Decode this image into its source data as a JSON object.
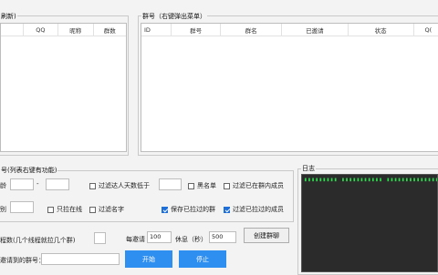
{
  "left_list": {
    "title": "刷新)",
    "columns": [
      "QQ",
      "昵称",
      "群数"
    ]
  },
  "groups": {
    "title": "群号（右键弹出菜单）",
    "columns": [
      "ID",
      "群号",
      "群名",
      "已邀请",
      "状态",
      "Q("
    ]
  },
  "settings": {
    "title": "号(列表右键有功能)",
    "age_label": "龄",
    "age_min": "",
    "age_sep": "-",
    "age_max": "",
    "gender_label": "别",
    "gender_value": "",
    "filter_fewer_label": "过滤达人天数低于",
    "filter_fewer_value": "",
    "blacklist_label": "黑名单",
    "filter_in_group_label": "过滤已在群内成员",
    "only_online_label": "只拉在线",
    "filter_nickname_label": "过滤名字",
    "save_pulled_label": "保存已拉过的群",
    "filter_pulled_label": "过滤已拉过的成员",
    "checks": {
      "filter_fewer": false,
      "blacklist": false,
      "filter_in_group": false,
      "only_online": false,
      "filter_nickname": false,
      "save_pulled": true,
      "filter_pulled": true
    }
  },
  "threads": {
    "label": "程数(几个线程就拉几个群)",
    "value": "",
    "per_invite_label": "每邀请",
    "per_invite_value": "100",
    "rest_label": "休息（秒）",
    "rest_value": "500",
    "create_group_button": "创建群聊",
    "target_label": "邀请到的群号：",
    "target_value": "",
    "start_button": "开始",
    "stop_button": "停止"
  },
  "log": {
    "title": "日志",
    "line": "▮▮▮▮▮▮▮▮▮ ▮▮▮▮▮▮▮▮▮▮▮ ▮▮▮▮▮▮▮▮▮▮▮▮▮▮▮▮▮▮▮▮▮▮▮▮▮▮"
  },
  "colors": {
    "accent": "#2f8ff0",
    "log_text": "#2bd94a",
    "log_bg": "#2b2b2b"
  }
}
